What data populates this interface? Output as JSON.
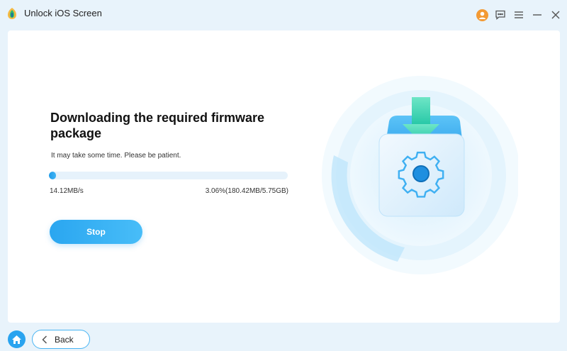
{
  "app": {
    "title": "Unlock iOS Screen",
    "accent_color": "#29a3ef",
    "window_controls": [
      "user-icon",
      "feedback-icon",
      "menu-icon",
      "minimize-icon",
      "close-icon"
    ]
  },
  "main": {
    "heading": "Downloading the required firmware package",
    "subtext": "It may take some time. Please be patient.",
    "progress": {
      "percent": 3.06,
      "speed": "14.12MB/s",
      "detail": "3.06%(180.42MB/5.75GB)"
    },
    "stop_label": "Stop",
    "illustration_icon": "firmware-download-gear-icon"
  },
  "footer": {
    "home_icon": "home-icon",
    "back_label": "Back"
  }
}
